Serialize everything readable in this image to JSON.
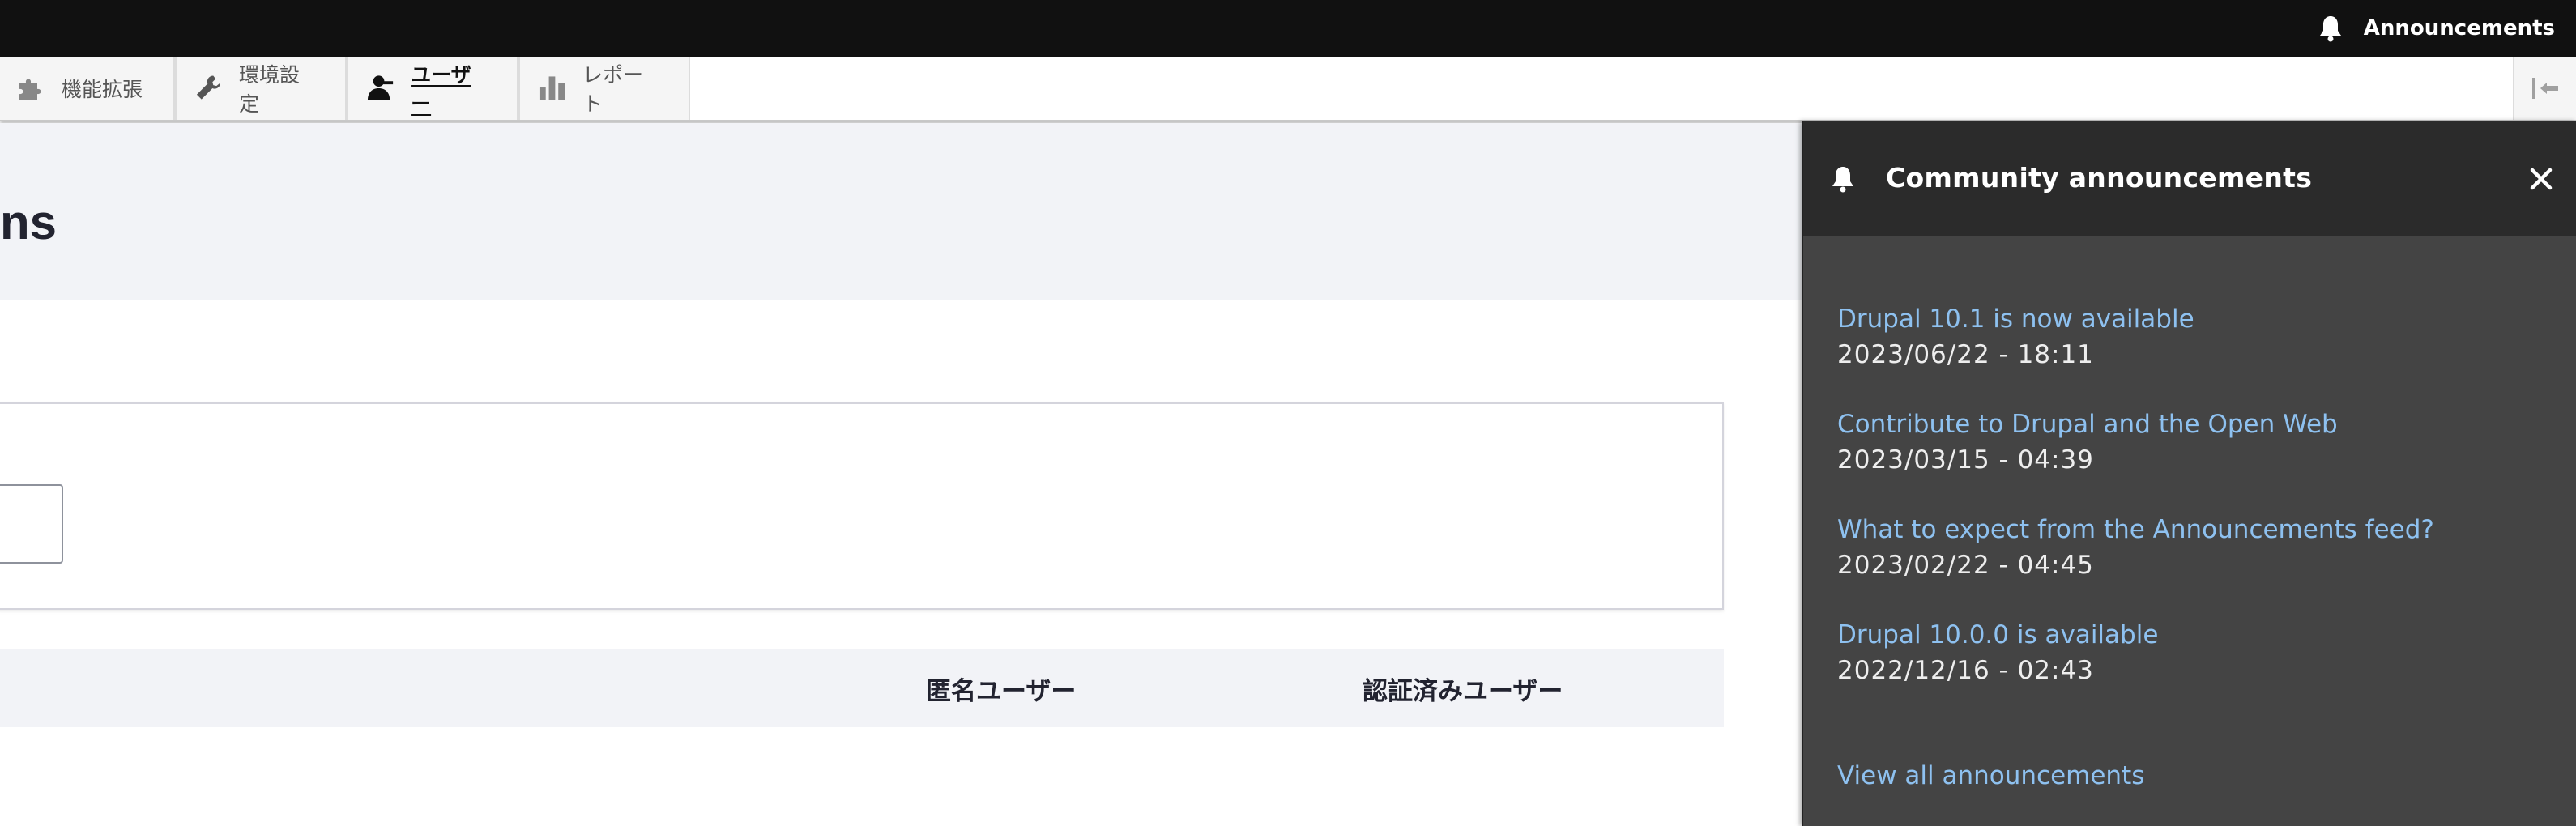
{
  "topbar": {
    "announcements_label": "Announcements"
  },
  "tray": {
    "items": [
      {
        "label": "機能拡張",
        "icon": "puzzle-icon"
      },
      {
        "label": "環境設定",
        "icon": "wrench-icon"
      },
      {
        "label": "ユーザー",
        "icon": "user-icon",
        "active": true
      },
      {
        "label": "レポート",
        "icon": "bar-chart-icon"
      }
    ]
  },
  "main": {
    "page_title_fragment": "ns",
    "table_headers": [
      "匿名ユーザー",
      "認証済みユーザー"
    ]
  },
  "panel": {
    "title": "Community announcements",
    "announcements": [
      {
        "title": "Drupal 10.1 is now available",
        "date": "2023/06/22 - 18:11"
      },
      {
        "title": "Contribute to Drupal and the Open Web",
        "date": "2023/03/15 - 04:39"
      },
      {
        "title": "What to expect from the Announcements feed?",
        "date": "2023/02/22 - 04:45"
      },
      {
        "title": "Drupal 10.0.0 is available",
        "date": "2022/12/16 - 02:43"
      }
    ],
    "view_all": "View all announcements"
  },
  "colors": {
    "topbar": "#111111",
    "panel_bg": "#444444",
    "panel_header": "#2b2b2b",
    "link": "#8ec1f0",
    "header_bg": "#f2f3f7"
  }
}
